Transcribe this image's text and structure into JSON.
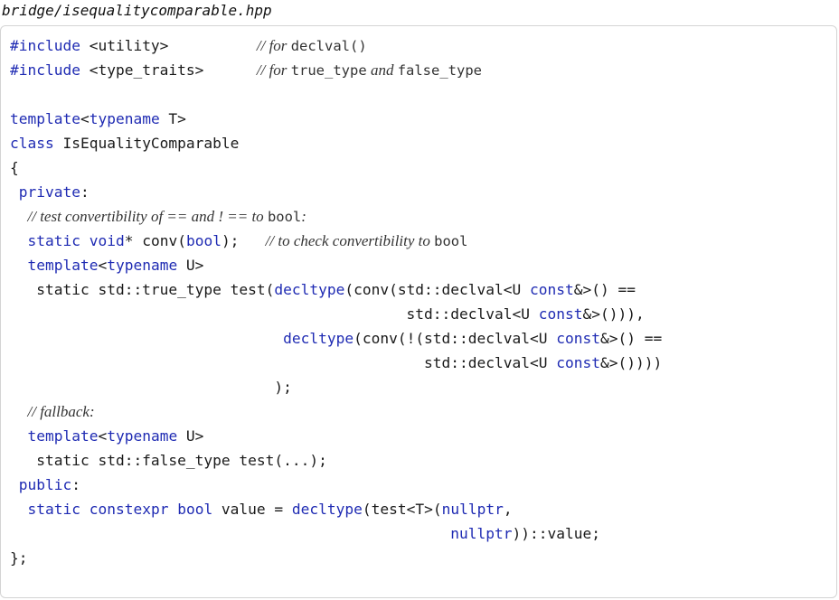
{
  "file": {
    "name": "bridge/isequalitycomparable.hpp"
  },
  "code": {
    "lines": [
      {
        "tokens": [
          {
            "t": "#include",
            "k": "kw"
          },
          {
            "t": " <utility>          ",
            "k": ""
          },
          {
            "t": "// for ",
            "k": "cm"
          },
          {
            "t": "declval()",
            "k": "cmtt"
          }
        ]
      },
      {
        "tokens": [
          {
            "t": "#include",
            "k": "kw"
          },
          {
            "t": " <type_traits>      ",
            "k": ""
          },
          {
            "t": "// for ",
            "k": "cm"
          },
          {
            "t": "true_type",
            "k": "cmtt"
          },
          {
            "t": " and ",
            "k": "cm"
          },
          {
            "t": "false_type",
            "k": "cmtt"
          }
        ]
      },
      {
        "tokens": []
      },
      {
        "tokens": [
          {
            "t": "template",
            "k": "kw"
          },
          {
            "t": "<",
            "k": ""
          },
          {
            "t": "typename",
            "k": "kw"
          },
          {
            "t": " T>",
            "k": ""
          }
        ]
      },
      {
        "tokens": [
          {
            "t": "class",
            "k": "kw"
          },
          {
            "t": " IsEqualityComparable",
            "k": ""
          }
        ]
      },
      {
        "tokens": [
          {
            "t": "{",
            "k": ""
          }
        ]
      },
      {
        "tokens": [
          {
            "t": " ",
            "k": ""
          },
          {
            "t": "private",
            "k": "kw"
          },
          {
            "t": ":",
            "k": ""
          }
        ]
      },
      {
        "tokens": [
          {
            "t": "  ",
            "k": ""
          },
          {
            "t": "// test convertibility of == and ! == to ",
            "k": "cm"
          },
          {
            "t": "bool",
            "k": "cmtt"
          },
          {
            "t": ":",
            "k": "cm"
          }
        ]
      },
      {
        "tokens": [
          {
            "t": "  ",
            "k": ""
          },
          {
            "t": "static",
            "k": "kw"
          },
          {
            "t": " ",
            "k": ""
          },
          {
            "t": "void",
            "k": "kw"
          },
          {
            "t": "* conv(",
            "k": ""
          },
          {
            "t": "bool",
            "k": "kw"
          },
          {
            "t": ");   ",
            "k": ""
          },
          {
            "t": "// to check convertibility to ",
            "k": "cm"
          },
          {
            "t": "bool",
            "k": "cmtt"
          }
        ]
      },
      {
        "tokens": [
          {
            "t": "  ",
            "k": ""
          },
          {
            "t": "template",
            "k": "kw"
          },
          {
            "t": "<",
            "k": ""
          },
          {
            "t": "typename",
            "k": "kw"
          },
          {
            "t": " U>",
            "k": ""
          }
        ]
      },
      {
        "tokens": [
          {
            "t": "   static std::true_type test(",
            "k": ""
          },
          {
            "t": "decltype",
            "k": "kw"
          },
          {
            "t": "(conv(std::declval<U ",
            "k": ""
          },
          {
            "t": "const",
            "k": "kw"
          },
          {
            "t": "&>() ==",
            "k": ""
          }
        ]
      },
      {
        "tokens": [
          {
            "t": "                                             std::declval<U ",
            "k": ""
          },
          {
            "t": "const",
            "k": "kw"
          },
          {
            "t": "&>())),",
            "k": ""
          }
        ]
      },
      {
        "tokens": [
          {
            "t": "                               ",
            "k": ""
          },
          {
            "t": "decltype",
            "k": "kw"
          },
          {
            "t": "(conv(!(std::declval<U ",
            "k": ""
          },
          {
            "t": "const",
            "k": "kw"
          },
          {
            "t": "&>() ==",
            "k": ""
          }
        ]
      },
      {
        "tokens": [
          {
            "t": "                                               std::declval<U ",
            "k": ""
          },
          {
            "t": "const",
            "k": "kw"
          },
          {
            "t": "&>())))",
            "k": ""
          }
        ]
      },
      {
        "tokens": [
          {
            "t": "                              );",
            "k": ""
          }
        ]
      },
      {
        "tokens": [
          {
            "t": "  ",
            "k": ""
          },
          {
            "t": "// fallback:",
            "k": "cm"
          }
        ]
      },
      {
        "tokens": [
          {
            "t": "  ",
            "k": ""
          },
          {
            "t": "template",
            "k": "kw"
          },
          {
            "t": "<",
            "k": ""
          },
          {
            "t": "typename",
            "k": "kw"
          },
          {
            "t": " U>",
            "k": ""
          }
        ]
      },
      {
        "tokens": [
          {
            "t": "   static std::false_type test(...);",
            "k": ""
          }
        ]
      },
      {
        "tokens": [
          {
            "t": " ",
            "k": ""
          },
          {
            "t": "public",
            "k": "kw"
          },
          {
            "t": ":",
            "k": ""
          }
        ]
      },
      {
        "tokens": [
          {
            "t": "  ",
            "k": ""
          },
          {
            "t": "static",
            "k": "kw"
          },
          {
            "t": " ",
            "k": ""
          },
          {
            "t": "constexpr",
            "k": "kw"
          },
          {
            "t": " ",
            "k": ""
          },
          {
            "t": "bool",
            "k": "kw"
          },
          {
            "t": " value = ",
            "k": ""
          },
          {
            "t": "decltype",
            "k": "kw"
          },
          {
            "t": "(test<T>(",
            "k": ""
          },
          {
            "t": "nullptr",
            "k": "kw"
          },
          {
            "t": ",",
            "k": ""
          }
        ]
      },
      {
        "tokens": [
          {
            "t": "                                                  ",
            "k": ""
          },
          {
            "t": "nullptr",
            "k": "kw"
          },
          {
            "t": "))::value;",
            "k": ""
          }
        ]
      },
      {
        "tokens": [
          {
            "t": "};",
            "k": ""
          }
        ]
      }
    ]
  }
}
